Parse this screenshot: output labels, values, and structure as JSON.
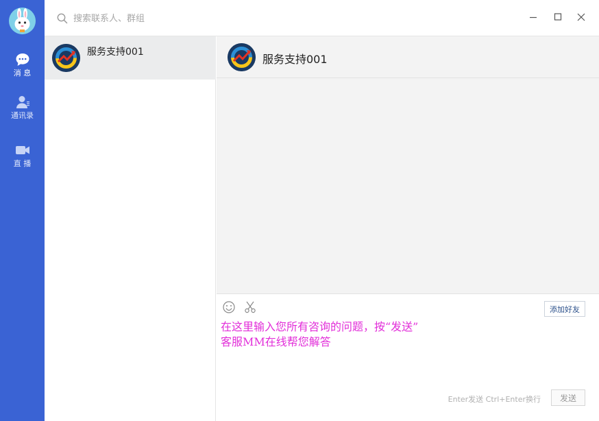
{
  "nav": {
    "items": [
      {
        "label": "消 息",
        "icon": "chat-bubble-icon",
        "active": true
      },
      {
        "label": "通讯录",
        "icon": "contacts-icon",
        "active": false
      },
      {
        "label": "直 播",
        "icon": "video-camera-icon",
        "active": false
      }
    ]
  },
  "search": {
    "placeholder": "搜索联系人、群组"
  },
  "contacts": [
    {
      "name": "服务支持001",
      "selected": true
    }
  ],
  "chat": {
    "title": "服务支持001",
    "add_friend_label": "添加好友",
    "input_text": "在这里输入您所有咨询的问题，按“发送”\n客服MM在线帮您解答",
    "hint": "Enter发送 Ctrl+Enter换行",
    "send_label": "发送"
  },
  "colors": {
    "nav_bg": "#3a63d4",
    "input_text": "#e22ed9"
  }
}
